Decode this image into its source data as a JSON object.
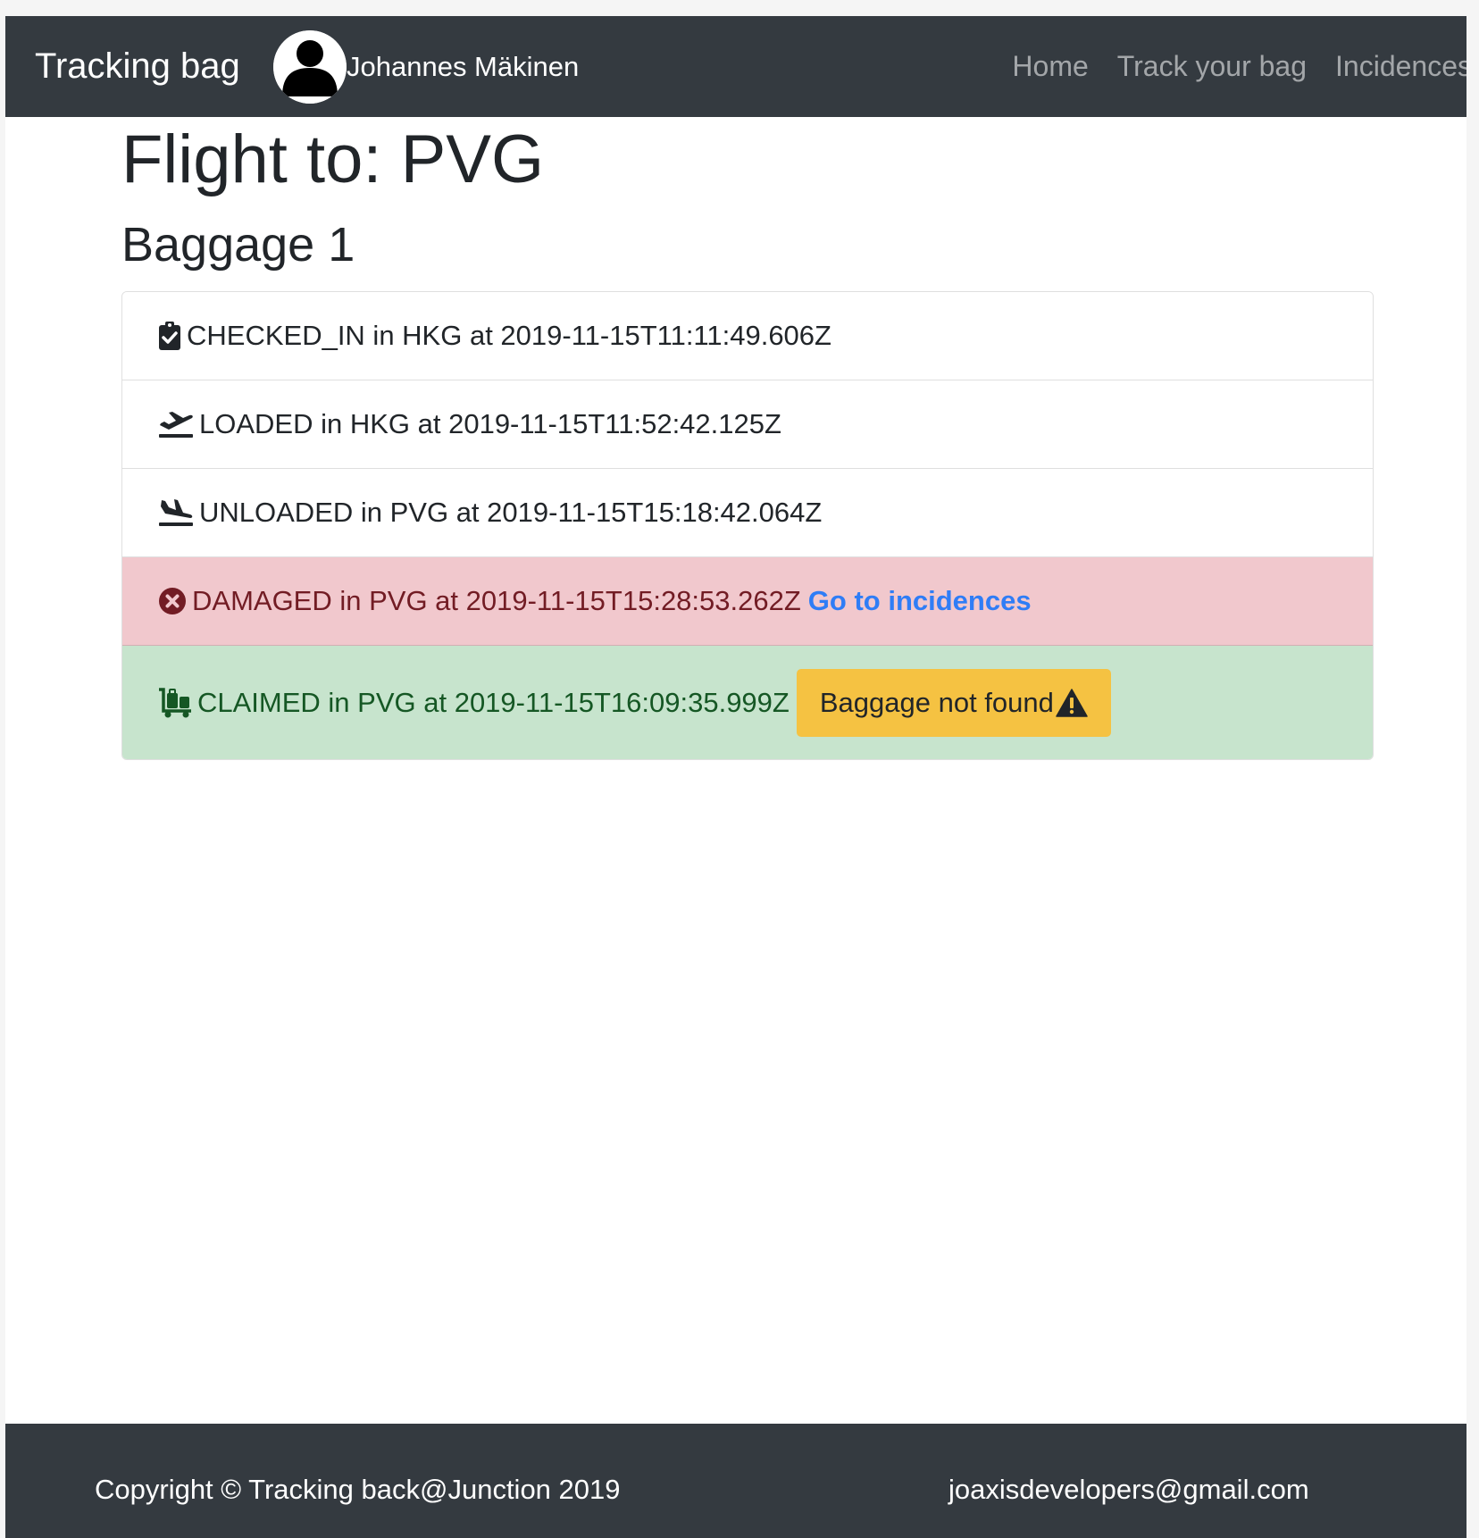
{
  "navbar": {
    "brand": "Tracking bag",
    "user_name": "Johannes Mäkinen",
    "links": [
      {
        "label": "Home"
      },
      {
        "label": "Track your bag"
      },
      {
        "label": "Incidences"
      }
    ]
  },
  "main": {
    "flight_title": "Flight to: PVG",
    "baggage_title": "Baggage 1",
    "events": [
      {
        "icon": "clipboard-check-icon",
        "text": "CHECKED_IN in HKG at 2019-11-15T11:11:49.606Z",
        "status": "default"
      },
      {
        "icon": "plane-departure-icon",
        "text": "LOADED in HKG at 2019-11-15T11:52:42.125Z",
        "status": "default"
      },
      {
        "icon": "plane-arrival-icon",
        "text": "UNLOADED in PVG at 2019-11-15T15:18:42.064Z",
        "status": "default"
      },
      {
        "icon": "times-circle-icon",
        "text": "DAMAGED in PVG at 2019-11-15T15:28:53.262Z",
        "status": "danger",
        "link_label": "Go to incidences"
      },
      {
        "icon": "luggage-cart-icon",
        "text": "CLAIMED in PVG at 2019-11-15T16:09:35.999Z",
        "status": "success",
        "button_label": "Baggage not found",
        "button_icon": "warning-triangle-icon"
      }
    ]
  },
  "footer": {
    "copyright": "Copyright © Tracking back@Junction 2019",
    "email": "joaxisdevelopers@gmail.com"
  },
  "colors": {
    "navbar_bg": "#343a40",
    "danger_bg": "#f1c8cd",
    "danger_text": "#721c24",
    "success_bg": "#c7e4cd",
    "success_text": "#155724",
    "link": "#2f7df6",
    "warning_button": "#f5c242"
  }
}
